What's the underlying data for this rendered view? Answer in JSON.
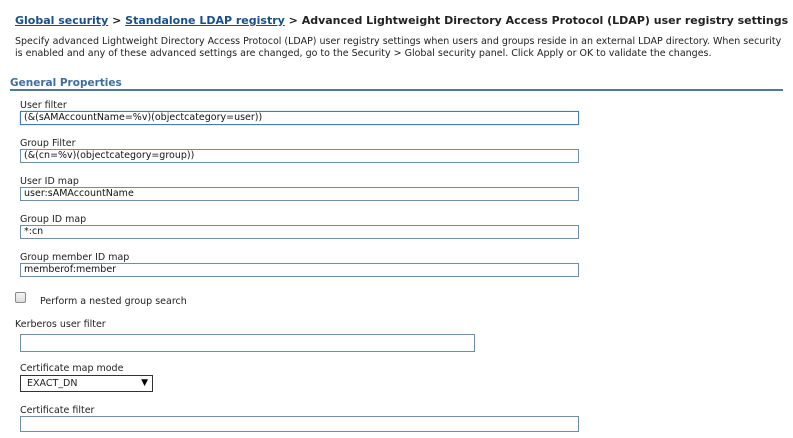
{
  "breadcrumb": {
    "link1": "Global security",
    "sep1": " > ",
    "link2": "Standalone LDAP registry",
    "sep2": " > ",
    "current": "Advanced Lightweight Directory Access Protocol (LDAP) user registry settings"
  },
  "description": "Specify advanced Lightweight Directory Access Protocol (LDAP) user registry settings when users and groups reside in an external LDAP directory. When security is enabled and any of these advanced settings are changed, go to the Security > Global security panel. Click Apply or OK to validate the changes.",
  "section": {
    "title": "General Properties"
  },
  "fields": {
    "user_filter": {
      "label": "User filter",
      "value": "(&(sAMAccountName=%v)(objectcategory=user))"
    },
    "group_filter": {
      "label": "Group Filter",
      "value": "(&(cn=%v)(objectcategory=group))"
    },
    "user_id_map": {
      "label": "User ID map",
      "value": "user:sAMAccountName"
    },
    "group_id_map": {
      "label": "Group ID map",
      "value": "*:cn"
    },
    "group_member_id_map": {
      "label": "Group member ID map",
      "value": "memberof:member"
    },
    "nested_group": {
      "label": "Perform a nested group search",
      "checked": false
    },
    "kerberos_user_filter": {
      "label": "Kerberos user filter",
      "value": ""
    },
    "certificate_map_mode": {
      "label": "Certificate map mode",
      "value": "EXACT_DN"
    },
    "certificate_filter": {
      "label": "Certificate filter",
      "value": ""
    }
  }
}
